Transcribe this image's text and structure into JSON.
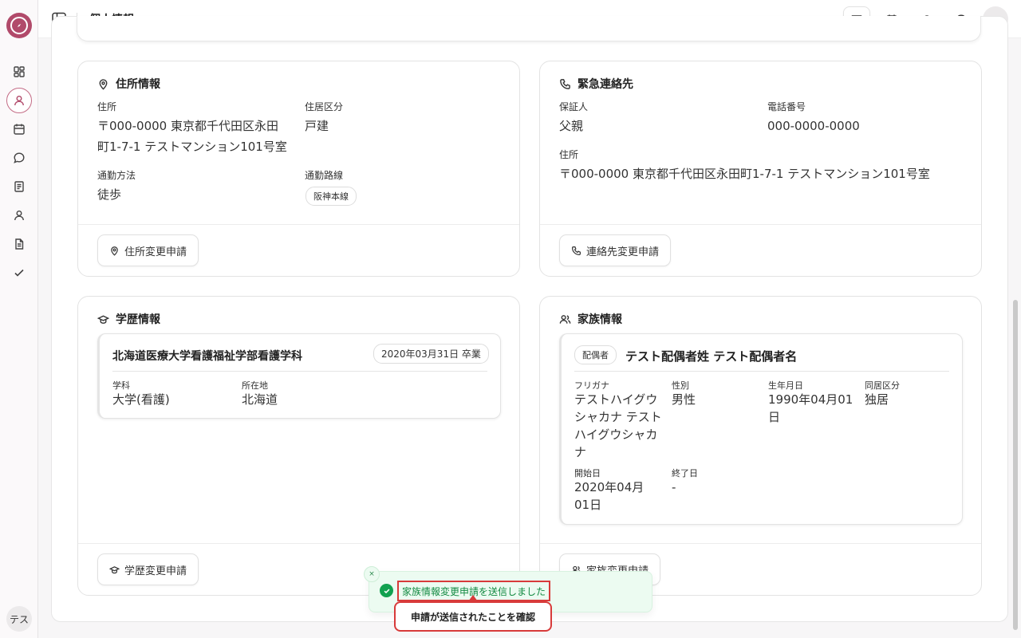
{
  "header": {
    "title": "個人情報",
    "avatar": "テ"
  },
  "sidebar": {
    "user_avatar": "テス"
  },
  "address_card": {
    "title": "住所情報",
    "address_label": "住所",
    "address_value": "〒000-0000 東京都千代田区永田町1-7-1 テストマンション101号室",
    "housing_label": "住居区分",
    "housing_value": "戸建",
    "commute_method_label": "通勤方法",
    "commute_method_value": "徒歩",
    "commute_route_label": "通勤路線",
    "commute_route_value": "阪神本線",
    "button_label": "住所変更申請"
  },
  "emergency_card": {
    "title": "緊急連絡先",
    "guarantor_label": "保証人",
    "guarantor_value": "父親",
    "phone_label": "電話番号",
    "phone_value": "000-0000-0000",
    "address_label": "住所",
    "address_value": "〒000-0000 東京都千代田区永田町1-7-1 テストマンション101号室",
    "button_label": "連絡先変更申請"
  },
  "education_card": {
    "title": "学歴情報",
    "school_name": "北海道医療大学看護福祉学部看護学科",
    "graduation_badge": "2020年03月31日 卒業",
    "department_label": "学科",
    "department_value": "大学(看護)",
    "location_label": "所在地",
    "location_value": "北海道",
    "button_label": "学歴変更申請"
  },
  "family_card": {
    "title": "家族情報",
    "relation_badge": "配偶者",
    "member_name": "テスト配偶者姓 テスト配偶者名",
    "furigana_label": "フリガナ",
    "furigana_value": "テストハイグウシャカナ テストハイグウシャカナ",
    "gender_label": "性別",
    "gender_value": "男性",
    "birthdate_label": "生年月日",
    "birthdate_value": "1990年04月01日",
    "living_label": "同居区分",
    "living_value": "独居",
    "start_label": "開始日",
    "start_value": "2020年04月01日",
    "end_label": "終了日",
    "end_value": "-",
    "button_label": "家族変更申請"
  },
  "toast": {
    "message": "家族情報変更申請を送信しました",
    "close": "×"
  },
  "annotation": {
    "callout": "申請が送信されたことを確認"
  },
  "colors": {
    "brand": "#b14a6a",
    "success": "#12a150",
    "highlight": "#d83a3a"
  }
}
